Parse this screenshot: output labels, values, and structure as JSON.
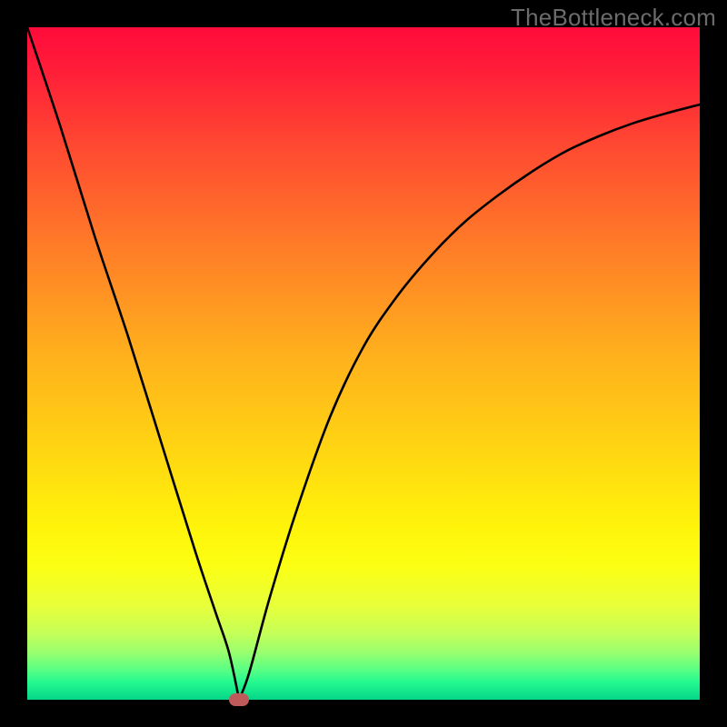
{
  "watermark": "TheBottleneck.com",
  "chart_data": {
    "type": "line",
    "title": "",
    "xlabel": "",
    "ylabel": "",
    "xlim": [
      0,
      100
    ],
    "ylim": [
      0,
      100
    ],
    "grid": false,
    "series": [
      {
        "name": "bottleneck-curve",
        "x": [
          0,
          5,
          10,
          15,
          20,
          25,
          28,
          30,
          31.5,
          33,
          36,
          40,
          45,
          50,
          55,
          60,
          65,
          70,
          75,
          80,
          85,
          90,
          95,
          100
        ],
        "values": [
          100,
          85,
          69,
          54,
          38,
          22,
          13,
          7,
          0,
          4,
          15,
          28,
          42,
          52.5,
          60,
          66,
          71,
          75,
          78.5,
          81.5,
          83.8,
          85.7,
          87.2,
          88.5
        ]
      }
    ],
    "annotations": [
      {
        "name": "minimum-marker",
        "x": 31.5,
        "y": 0
      }
    ],
    "background_gradient": [
      {
        "offset": 0.0,
        "color": "#ff0b3a"
      },
      {
        "offset": 0.06,
        "color": "#ff1c39"
      },
      {
        "offset": 0.18,
        "color": "#ff4a31"
      },
      {
        "offset": 0.32,
        "color": "#ff7a28"
      },
      {
        "offset": 0.48,
        "color": "#ffae1d"
      },
      {
        "offset": 0.62,
        "color": "#ffd313"
      },
      {
        "offset": 0.74,
        "color": "#fff30a"
      },
      {
        "offset": 0.8,
        "color": "#fcff13"
      },
      {
        "offset": 0.86,
        "color": "#e8ff3a"
      },
      {
        "offset": 0.9,
        "color": "#c6ff56"
      },
      {
        "offset": 0.93,
        "color": "#98ff6e"
      },
      {
        "offset": 0.955,
        "color": "#5aff83"
      },
      {
        "offset": 0.975,
        "color": "#22f890"
      },
      {
        "offset": 1.0,
        "color": "#05d688"
      }
    ]
  }
}
